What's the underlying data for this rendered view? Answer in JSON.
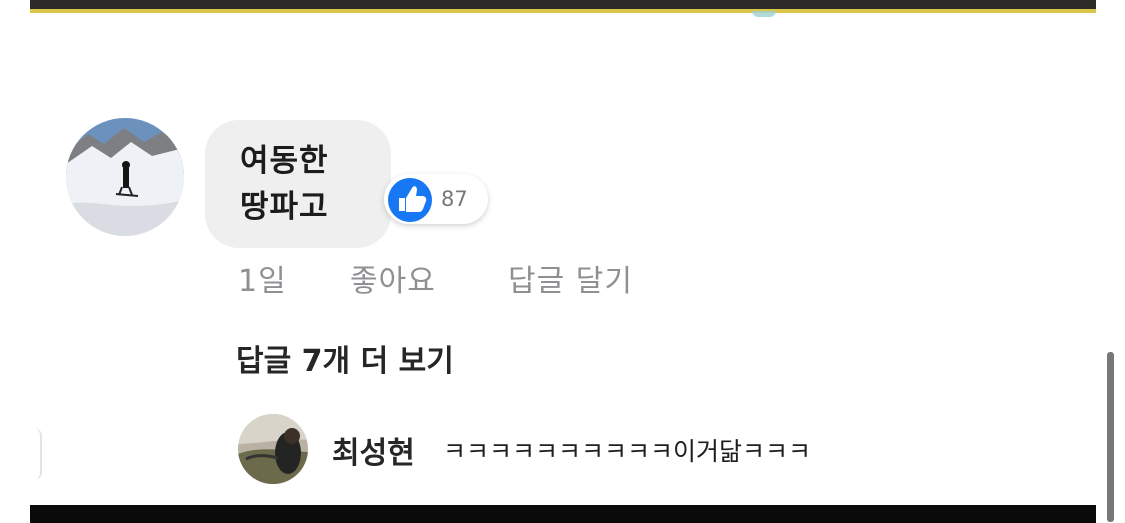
{
  "comment": {
    "author_avatar": "avatar-snowy-mountain",
    "text": "여동한\n땅파고",
    "reaction": {
      "icon": "thumbs-up-icon",
      "count": "87"
    },
    "meta": {
      "time": "1일",
      "like_label": "좋아요",
      "reply_label": "답글 달기"
    }
  },
  "replies": {
    "more_label": "답글 7개 더 보기",
    "preview": {
      "author": "최성현",
      "text": "ㅋㅋㅋㅋㅋㅋㅋㅋㅋㅋ이거닮ㅋㅋㅋ"
    }
  },
  "colors": {
    "like_blue": "#1877f2",
    "bubble_gray": "#efefef",
    "meta_gray": "#8e9093"
  }
}
